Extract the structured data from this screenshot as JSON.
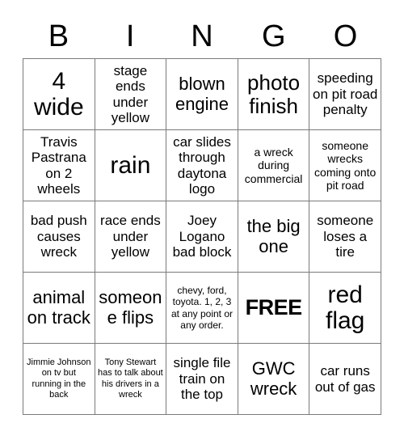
{
  "card": {
    "title": "BINGO",
    "header_letters": [
      "B",
      "I",
      "N",
      "G",
      "O"
    ],
    "columns": 5,
    "rows": 5,
    "text_color": "#000000",
    "background_color": "#ffffff",
    "grid_line_color": "#7a7a7a"
  },
  "cells": [
    {
      "row": 1,
      "col": 1,
      "text": "4 wide",
      "size": "fs-xxl",
      "free": false
    },
    {
      "row": 1,
      "col": 2,
      "text": "stage ends under yellow",
      "size": "fs-m",
      "free": false
    },
    {
      "row": 1,
      "col": 3,
      "text": "blown engine",
      "size": "fs-l",
      "free": false
    },
    {
      "row": 1,
      "col": 4,
      "text": "photo finish",
      "size": "fs-xl",
      "free": false
    },
    {
      "row": 1,
      "col": 5,
      "text": "speeding on pit road penalty",
      "size": "fs-m",
      "free": false
    },
    {
      "row": 2,
      "col": 1,
      "text": "Travis Pastrana on 2 wheels",
      "size": "fs-m",
      "free": false
    },
    {
      "row": 2,
      "col": 2,
      "text": "rain",
      "size": "fs-xxl",
      "free": false
    },
    {
      "row": 2,
      "col": 3,
      "text": "car slides through daytona logo",
      "size": "fs-m",
      "free": false
    },
    {
      "row": 2,
      "col": 4,
      "text": "a wreck during commercial",
      "size": "fs-s",
      "free": false
    },
    {
      "row": 2,
      "col": 5,
      "text": "someone wrecks coming onto pit road",
      "size": "fs-s",
      "free": false
    },
    {
      "row": 3,
      "col": 1,
      "text": "bad push causes wreck",
      "size": "fs-m",
      "free": false
    },
    {
      "row": 3,
      "col": 2,
      "text": "race ends under yellow",
      "size": "fs-m",
      "free": false
    },
    {
      "row": 3,
      "col": 3,
      "text": "Joey Logano bad block",
      "size": "fs-m",
      "free": false
    },
    {
      "row": 3,
      "col": 4,
      "text": "the big one",
      "size": "fs-l",
      "free": false
    },
    {
      "row": 3,
      "col": 5,
      "text": "someone loses a tire",
      "size": "fs-m",
      "free": false
    },
    {
      "row": 4,
      "col": 1,
      "text": "animal on track",
      "size": "fs-l",
      "free": false
    },
    {
      "row": 4,
      "col": 2,
      "text": "someone flips",
      "size": "fs-l",
      "free": false
    },
    {
      "row": 4,
      "col": 3,
      "text": "chevy, ford, toyota. 1, 2, 3 at any point or any order.",
      "size": "fs-xs",
      "free": false
    },
    {
      "row": 4,
      "col": 4,
      "text": "FREE",
      "size": "fs-xl",
      "free": true
    },
    {
      "row": 4,
      "col": 5,
      "text": "red flag",
      "size": "fs-xxl",
      "free": false
    },
    {
      "row": 5,
      "col": 1,
      "text": "Jimmie Johnson on tv but running in the back",
      "size": "fs-xxs",
      "free": false
    },
    {
      "row": 5,
      "col": 2,
      "text": "Tony Stewart has to talk about his drivers in a wreck",
      "size": "fs-xxs",
      "free": false
    },
    {
      "row": 5,
      "col": 3,
      "text": "single file train on the top",
      "size": "fs-m",
      "free": false
    },
    {
      "row": 5,
      "col": 4,
      "text": "GWC wreck",
      "size": "fs-l",
      "free": false
    },
    {
      "row": 5,
      "col": 5,
      "text": "car runs out of gas",
      "size": "fs-m",
      "free": false
    }
  ]
}
